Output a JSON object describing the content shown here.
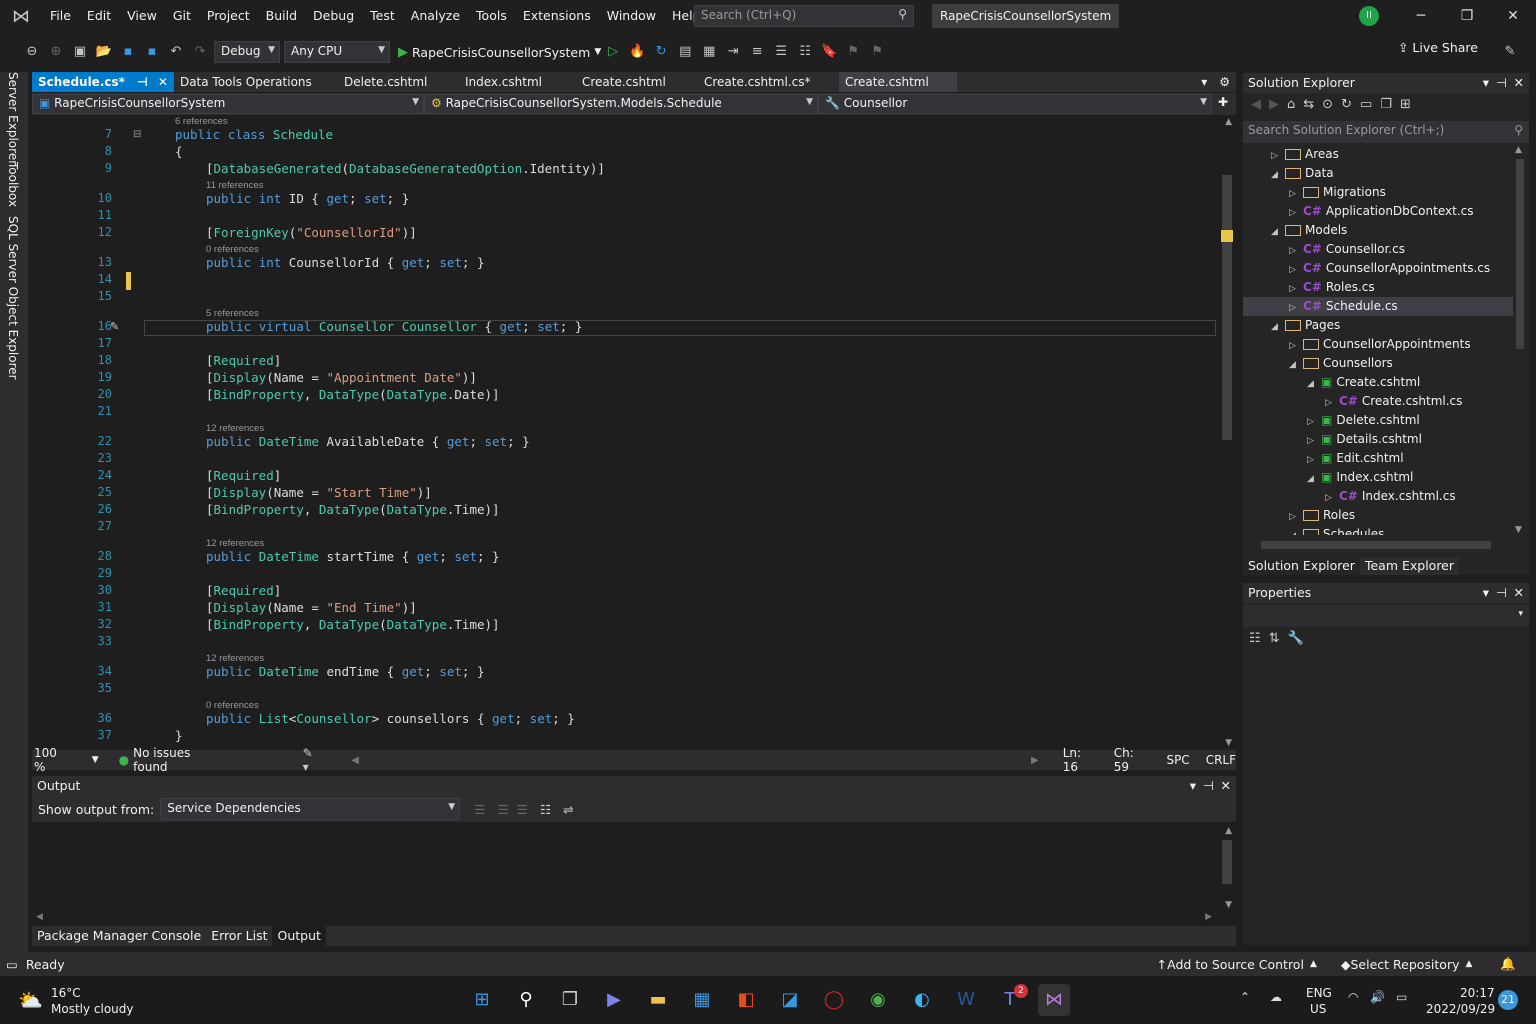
{
  "menu": [
    "File",
    "Edit",
    "View",
    "Git",
    "Project",
    "Build",
    "Debug",
    "Test",
    "Analyze",
    "Tools",
    "Extensions",
    "Window",
    "Help"
  ],
  "search": {
    "placeholder": "Search (Ctrl+Q)"
  },
  "solution_name": "RapeCrisisCounsellorSystem",
  "avatar": "II",
  "toolbar": {
    "config": "Debug",
    "platform": "Any CPU",
    "run_target": "RapeCrisisCounsellorSystem",
    "live_share": "Live Share"
  },
  "side_labels": [
    "Server Explorer",
    "Toolbox",
    "SQL Server Object Explorer"
  ],
  "tabs": [
    {
      "label": "Schedule.cs*"
    },
    {
      "label": "Data Tools Operations"
    },
    {
      "label": "Delete.cshtml"
    },
    {
      "label": "Index.cshtml"
    },
    {
      "label": "Create.cshtml"
    },
    {
      "label": "Create.cshtml.cs*"
    },
    {
      "label": "Create.cshtml"
    }
  ],
  "nav": {
    "project": "RapeCrisisCounsellorSystem",
    "type": "RapeCrisisCounsellorSystem.Models.Schedule",
    "member": "Counsellor"
  },
  "refs": {
    "r7": "6 references",
    "r10": "11 references",
    "r13": "0 references",
    "r16": "5 references",
    "r22": "12 references",
    "r28": "12 references",
    "r34": "12 references",
    "r36": "0 references"
  },
  "line_numbers": [
    "7",
    "8",
    "9",
    "10",
    "11",
    "12",
    "13",
    "14",
    "15",
    "16",
    "17",
    "18",
    "19",
    "20",
    "21",
    "22",
    "23",
    "24",
    "25",
    "26",
    "27",
    "28",
    "29",
    "30",
    "31",
    "32",
    "33",
    "34",
    "35",
    "36",
    "37"
  ],
  "code": {
    "l7": "public class Schedule",
    "l8": "{",
    "l9": "[DatabaseGenerated(DatabaseGeneratedOption.Identity)]",
    "l10": "public int ID { get; set; }",
    "l12": "[ForeignKey(\"CounsellorId\")]",
    "l13": "public int CounsellorId { get; set; }",
    "l16": "public virtual Counsellor Counsellor { get; set; }",
    "l18": "[Required]",
    "l19": "[Display(Name = \"Appointment Date\")]",
    "l20": "[BindProperty, DataType(DataType.Date)]",
    "l22": "public DateTime AvailableDate { get; set; }",
    "l24": "[Required]",
    "l25": "[Display(Name = \"Start Time\")]",
    "l26": "[BindProperty, DataType(DataType.Time)]",
    "l28": "public DateTime startTime { get; set; }",
    "l30": "[Required]",
    "l31": "[Display(Name = \"End Time\")]",
    "l32": "[BindProperty, DataType(DataType.Time)]",
    "l34": "public DateTime endTime { get; set; }",
    "l36": "public List<Counsellor> counsellors { get; set; }",
    "l37": "}"
  },
  "editor_status": {
    "zoom": "100 %",
    "issues": "No issues found",
    "ln": "Ln: 16",
    "ch": "Ch: 59",
    "spc": "SPC",
    "eol": "CRLF"
  },
  "output": {
    "title": "Output",
    "show_from_label": "Show output from:",
    "source": "Service Dependencies"
  },
  "bottom_tabs": [
    "Package Manager Console",
    "Error List",
    "Output"
  ],
  "solution_explorer": {
    "title": "Solution Explorer",
    "search_placeholder": "Search Solution Explorer (Ctrl+;)",
    "tree": [
      "Areas",
      "Data",
      "Migrations",
      "ApplicationDbContext.cs",
      "Models",
      "Counsellor.cs",
      "CounsellorAppointments.cs",
      "Roles.cs",
      "Schedule.cs",
      "Pages",
      "CounsellorAppointments",
      "Counsellors",
      "Create.cshtml",
      "Create.cshtml.cs",
      "Delete.cshtml",
      "Details.cshtml",
      "Edit.cshtml",
      "Index.cshtml",
      "Index.cshtml.cs",
      "Roles",
      "Schedules"
    ],
    "tabs": [
      "Solution Explorer",
      "Team Explorer"
    ]
  },
  "properties": {
    "title": "Properties"
  },
  "status": {
    "ready": "Ready",
    "source_control": "Add to Source Control",
    "repo": "Select Repository"
  },
  "taskbar": {
    "temp": "16°C",
    "weather": "Mostly cloudy",
    "lang1": "ENG",
    "lang2": "US",
    "time": "20:17",
    "date": "2022/09/29",
    "notif": "21",
    "teams_badge": "2"
  },
  "colors": {
    "accent": "#007acc",
    "bg": "#1e1e1e",
    "keyword": "#569cd6",
    "type": "#4ec9b0",
    "string": "#d69d85"
  }
}
